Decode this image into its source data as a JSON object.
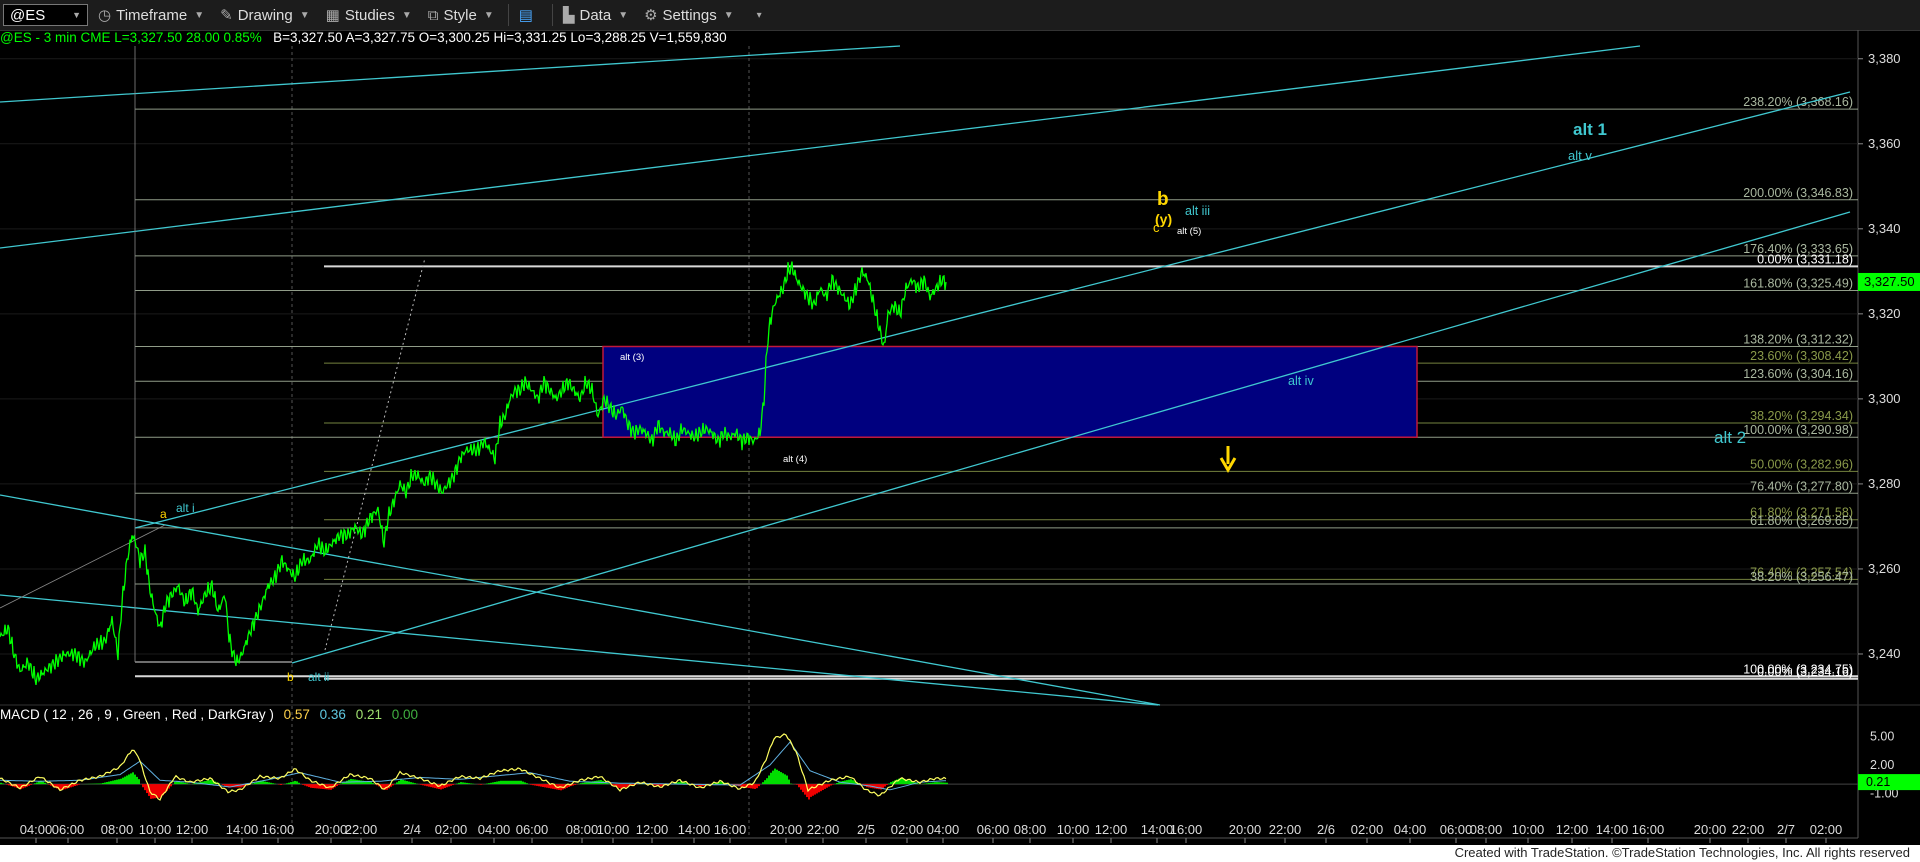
{
  "toolbar": {
    "symbol": "@ES",
    "timeframe": "Timeframe",
    "drawing": "Drawing",
    "studies": "Studies",
    "style": "Style",
    "data": "Data",
    "settings": "Settings"
  },
  "info": {
    "symbol": "@ES - 3 min  CME",
    "last": "L=3,327.50",
    "change": "28.00",
    "pct": "0.85%",
    "bid": "B=3,327.50",
    "ask": "A=3,327.75",
    "open": "O=3,300.25",
    "high": "Hi=3,331.25",
    "low": "Lo=3,288.25",
    "volume": "V=1,559,830"
  },
  "macd": {
    "label": "MACD ( 12 , 26 , 9 , Green , Red , DarkGray )",
    "v1": "0.57",
    "v2": "0.36",
    "v3": "0.21",
    "v4": "0.00",
    "axis": [
      "5.00",
      "2.00",
      "-1.00"
    ],
    "current": "0.21"
  },
  "footer": "Created with TradeStation. ©TradeStation Technologies, Inc. All rights reserved",
  "colors": {
    "price": "#00ff00",
    "channel": "#40c8d0",
    "box_fill": "#00007f",
    "box_border": "#c0183c",
    "fib": "#aab8a0",
    "yellow": "#ffd700",
    "macd_pos": "#00dd00",
    "macd_neg": "#ee0000",
    "signal": "#ffff60"
  },
  "chart_data": {
    "type": "line",
    "title": "@ES - 3 min CME",
    "ylim": [
      3228,
      3383
    ],
    "yticks": [
      3240,
      3260,
      3280,
      3300,
      3320,
      3340,
      3360,
      3380
    ],
    "ytick_labels": [
      "3,240",
      "3,260",
      "3,280",
      "3,300",
      "3,320",
      "3,340",
      "3,360",
      "3,380"
    ],
    "current_price": "3,327.50",
    "xtick_labels": [
      "04:00",
      "06:00",
      "08:00",
      "10:00",
      "12:00",
      "14:00",
      "16:00",
      "20:00",
      "22:00",
      "2/4",
      "02:00",
      "04:00",
      "06:00",
      "08:00",
      "10:00",
      "12:00",
      "14:00",
      "16:00",
      "20:00",
      "22:00",
      "2/5",
      "02:00",
      "04:00",
      "06:00",
      "08:00",
      "10:00",
      "12:00",
      "14:00",
      "16:00",
      "20:00",
      "22:00",
      "2/6",
      "02:00",
      "04:00",
      "06:00",
      "08:00",
      "10:00",
      "12:00",
      "14:00",
      "16:00",
      "20:00",
      "22:00",
      "2/7",
      "02:00"
    ],
    "series": [
      {
        "values": [
          [
            0,
            3244
          ],
          [
            8,
            3246
          ],
          [
            14,
            3240
          ],
          [
            20,
            3236
          ],
          [
            28,
            3238
          ],
          [
            36,
            3234
          ],
          [
            45,
            3236
          ],
          [
            55,
            3238
          ],
          [
            65,
            3240
          ],
          [
            75,
            3240
          ],
          [
            85,
            3238
          ],
          [
            95,
            3242
          ],
          [
            105,
            3243
          ],
          [
            112,
            3248
          ],
          [
            118,
            3240
          ],
          [
            122,
            3252
          ],
          [
            127,
            3262
          ],
          [
            132,
            3268
          ],
          [
            136,
            3266
          ],
          [
            140,
            3262
          ],
          [
            145,
            3264
          ],
          [
            150,
            3255
          ],
          [
            155,
            3250
          ],
          [
            160,
            3246
          ],
          [
            166,
            3252
          ],
          [
            172,
            3254
          ],
          [
            178,
            3256
          ],
          [
            185,
            3252
          ],
          [
            192,
            3255
          ],
          [
            198,
            3250
          ],
          [
            205,
            3254
          ],
          [
            212,
            3256
          ],
          [
            218,
            3250
          ],
          [
            225,
            3254
          ],
          [
            229,
            3244
          ],
          [
            233,
            3240
          ],
          [
            237,
            3238
          ],
          [
            242,
            3240
          ],
          [
            248,
            3244
          ],
          [
            255,
            3248
          ],
          [
            262,
            3252
          ],
          [
            268,
            3256
          ],
          [
            275,
            3258
          ],
          [
            282,
            3262
          ],
          [
            288,
            3260
          ],
          [
            295,
            3258
          ],
          [
            302,
            3262
          ],
          [
            310,
            3262
          ],
          [
            318,
            3266
          ],
          [
            325,
            3264
          ],
          [
            332,
            3266
          ],
          [
            340,
            3268
          ],
          [
            348,
            3268
          ],
          [
            355,
            3270
          ],
          [
            362,
            3268
          ],
          [
            370,
            3272
          ],
          [
            378,
            3274
          ],
          [
            384,
            3266
          ],
          [
            388,
            3272
          ],
          [
            394,
            3276
          ],
          [
            400,
            3280
          ],
          [
            406,
            3278
          ],
          [
            412,
            3282
          ],
          [
            418,
            3282
          ],
          [
            424,
            3280
          ],
          [
            430,
            3282
          ],
          [
            436,
            3280
          ],
          [
            442,
            3278
          ],
          [
            448,
            3280
          ],
          [
            454,
            3282
          ],
          [
            460,
            3286
          ],
          [
            466,
            3288
          ],
          [
            472,
            3288
          ],
          [
            478,
            3288
          ],
          [
            484,
            3290
          ],
          [
            490,
            3288
          ],
          [
            495,
            3286
          ],
          [
            500,
            3294
          ],
          [
            505,
            3296
          ],
          [
            510,
            3300
          ],
          [
            515,
            3302
          ],
          [
            520,
            3302
          ],
          [
            525,
            3304
          ],
          [
            532,
            3302
          ],
          [
            538,
            3300
          ],
          [
            544,
            3304
          ],
          [
            550,
            3302
          ],
          [
            556,
            3300
          ],
          [
            562,
            3302
          ],
          [
            568,
            3304
          ],
          [
            574,
            3302
          ],
          [
            580,
            3300
          ],
          [
            586,
            3304
          ],
          [
            592,
            3302
          ],
          [
            598,
            3296
          ],
          [
            604,
            3300
          ],
          [
            610,
            3298
          ],
          [
            616,
            3296
          ],
          [
            622,
            3298
          ],
          [
            628,
            3294
          ],
          [
            634,
            3292
          ],
          [
            640,
            3293
          ],
          [
            646,
            3292
          ],
          [
            652,
            3290
          ],
          [
            658,
            3294
          ],
          [
            664,
            3292
          ],
          [
            670,
            3292
          ],
          [
            676,
            3290
          ],
          [
            682,
            3293
          ],
          [
            688,
            3292
          ],
          [
            694,
            3291
          ],
          [
            700,
            3292
          ],
          [
            706,
            3293
          ],
          [
            712,
            3292
          ],
          [
            718,
            3290
          ],
          [
            724,
            3292
          ],
          [
            730,
            3291
          ],
          [
            736,
            3292
          ],
          [
            742,
            3290
          ],
          [
            748,
            3291
          ],
          [
            754,
            3290
          ],
          [
            760,
            3292
          ],
          [
            764,
            3300
          ],
          [
            767,
            3312
          ],
          [
            770,
            3318
          ],
          [
            774,
            3322
          ],
          [
            778,
            3324
          ],
          [
            783,
            3326
          ],
          [
            788,
            3330
          ],
          [
            792,
            3331
          ],
          [
            797,
            3328
          ],
          [
            802,
            3326
          ],
          [
            808,
            3324
          ],
          [
            814,
            3322
          ],
          [
            820,
            3326
          ],
          [
            826,
            3324
          ],
          [
            832,
            3328
          ],
          [
            838,
            3326
          ],
          [
            844,
            3324
          ],
          [
            850,
            3322
          ],
          [
            856,
            3326
          ],
          [
            862,
            3330
          ],
          [
            868,
            3328
          ],
          [
            874,
            3322
          ],
          [
            880,
            3316
          ],
          [
            884,
            3312
          ],
          [
            888,
            3320
          ],
          [
            894,
            3322
          ],
          [
            900,
            3320
          ],
          [
            906,
            3326
          ],
          [
            912,
            3328
          ],
          [
            918,
            3326
          ],
          [
            924,
            3328
          ],
          [
            930,
            3324
          ],
          [
            936,
            3326
          ],
          [
            942,
            3328
          ],
          [
            946,
            3327.5
          ]
        ]
      }
    ],
    "fib_levels": [
      {
        "label": "238.20% (3,368.16)",
        "price": 3368.16
      },
      {
        "label": "200.00% (3,346.83)",
        "price": 3346.83
      },
      {
        "label": "176.40% (3,333.65)",
        "price": 3333.65
      },
      {
        "label": "0.00% (3,331.18)",
        "price": 3331.18
      },
      {
        "label": "161.80% (3,325.49)",
        "price": 3325.49
      },
      {
        "label": "138.20% (3,312.32)",
        "price": 3312.32
      },
      {
        "label": "23.60% (3,308.42)",
        "price": 3308.42
      },
      {
        "label": "123.60% (3,304.16)",
        "price": 3304.16
      },
      {
        "label": "38.20% (3,294.34)",
        "price": 3294.34
      },
      {
        "label": "100.00% (3,290.98)",
        "price": 3290.98
      },
      {
        "label": "50.00% (3,282.96)",
        "price": 3282.96
      },
      {
        "label": "76.40% (3,277.80)",
        "price": 3277.8
      },
      {
        "label": "61.80% (3,271.58)",
        "price": 3271.58
      },
      {
        "label": "61.80% (3,269.65)",
        "price": 3269.65
      },
      {
        "label": "76.40% (3,257.54)",
        "price": 3257.54
      },
      {
        "label": "38.20% (3,256.47)",
        "price": 3256.47
      },
      {
        "label": "100.00% (3,234.75)",
        "price": 3234.75
      },
      {
        "label": "0.00% (3,234.16)",
        "price": 3234.16
      }
    ],
    "annotations": [
      {
        "text": "a",
        "color": "#ffd700"
      },
      {
        "text": "alt i",
        "color": "#40c8d0"
      },
      {
        "text": "b",
        "color": "#ffd700"
      },
      {
        "text": "alt ii",
        "color": "#40c8d0"
      },
      {
        "text": "alt (3)",
        "color": "#ffffff"
      },
      {
        "text": "alt (4)",
        "color": "#ffffff"
      },
      {
        "text": "b",
        "color": "#ffd700"
      },
      {
        "text": "(y)",
        "color": "#ffd700"
      },
      {
        "text": "c",
        "color": "#ffd700"
      },
      {
        "text": "alt iii",
        "color": "#40c8d0"
      },
      {
        "text": "alt (5)",
        "color": "#ffffff"
      },
      {
        "text": "alt iv",
        "color": "#40c8d0"
      },
      {
        "text": "alt 1",
        "color": "#40c8d0"
      },
      {
        "text": "alt v",
        "color": "#40c8d0"
      },
      {
        "text": "alt 2",
        "color": "#40c8d0"
      }
    ],
    "macd": {
      "values": [
        [
          0,
          0.6
        ],
        [
          20,
          -0.4
        ],
        [
          40,
          0.8
        ],
        [
          60,
          -0.6
        ],
        [
          80,
          0.4
        ],
        [
          100,
          0.8
        ],
        [
          120,
          1.8
        ],
        [
          132,
          3.6
        ],
        [
          138,
          3.0
        ],
        [
          150,
          -0.8
        ],
        [
          160,
          -1.6
        ],
        [
          175,
          0.8
        ],
        [
          190,
          0.2
        ],
        [
          210,
          0.6
        ],
        [
          228,
          -0.8
        ],
        [
          240,
          -0.6
        ],
        [
          260,
          0.8
        ],
        [
          280,
          0.6
        ],
        [
          295,
          1.6
        ],
        [
          310,
          0.4
        ],
        [
          330,
          -0.4
        ],
        [
          350,
          1.0
        ],
        [
          370,
          0.6
        ],
        [
          385,
          -0.6
        ],
        [
          400,
          1.2
        ],
        [
          420,
          0.6
        ],
        [
          440,
          -0.2
        ],
        [
          460,
          0.8
        ],
        [
          480,
          0.6
        ],
        [
          500,
          1.4
        ],
        [
          520,
          1.6
        ],
        [
          540,
          0.6
        ],
        [
          560,
          -0.4
        ],
        [
          580,
          0.4
        ],
        [
          600,
          0.8
        ],
        [
          620,
          -0.6
        ],
        [
          640,
          0.2
        ],
        [
          660,
          -0.3
        ],
        [
          680,
          0.4
        ],
        [
          700,
          -0.4
        ],
        [
          720,
          0.3
        ],
        [
          740,
          -0.5
        ],
        [
          755,
          0.2
        ],
        [
          766,
          2.6
        ],
        [
          774,
          4.8
        ],
        [
          786,
          5.2
        ],
        [
          796,
          3.4
        ],
        [
          808,
          -0.6
        ],
        [
          830,
          0.4
        ],
        [
          850,
          0.8
        ],
        [
          866,
          -0.6
        ],
        [
          880,
          -1.2
        ],
        [
          900,
          0.6
        ],
        [
          920,
          0.2
        ],
        [
          935,
          0.6
        ],
        [
          946,
          0.57
        ]
      ],
      "signal": [
        [
          0,
          0.4
        ],
        [
          40,
          0.3
        ],
        [
          80,
          0.4
        ],
        [
          120,
          1.0
        ],
        [
          140,
          2.4
        ],
        [
          160,
          0.4
        ],
        [
          190,
          0.2
        ],
        [
          230,
          -0.3
        ],
        [
          270,
          0.5
        ],
        [
          300,
          1.2
        ],
        [
          340,
          0.2
        ],
        [
          380,
          0.3
        ],
        [
          420,
          0.7
        ],
        [
          460,
          0.5
        ],
        [
          500,
          0.9
        ],
        [
          530,
          1.2
        ],
        [
          570,
          0.3
        ],
        [
          620,
          0.1
        ],
        [
          680,
          0.0
        ],
        [
          740,
          -0.1
        ],
        [
          770,
          2.0
        ],
        [
          790,
          4.4
        ],
        [
          810,
          1.4
        ],
        [
          840,
          0.2
        ],
        [
          870,
          -0.2
        ],
        [
          890,
          -0.6
        ],
        [
          920,
          0.2
        ],
        [
          946,
          0.36
        ]
      ],
      "ylim": [
        -2.5,
        6.5
      ]
    }
  }
}
